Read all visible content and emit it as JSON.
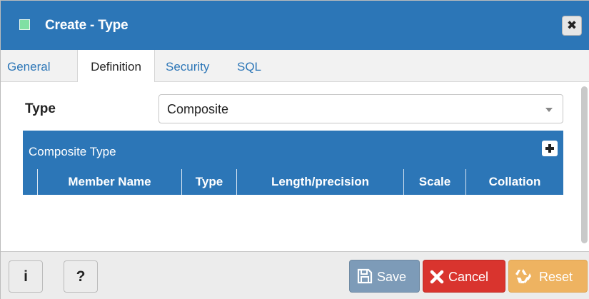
{
  "dialog": {
    "title": "Create - Type",
    "close_glyph": "✖",
    "icon": "type-icon"
  },
  "tabs": [
    {
      "label": "General",
      "active": false
    },
    {
      "label": "Definition",
      "active": true
    },
    {
      "label": "Security",
      "active": false
    },
    {
      "label": "SQL",
      "active": false
    }
  ],
  "form": {
    "type_label": "Type",
    "type_value": "Composite"
  },
  "composite": {
    "title": "Composite Type",
    "columns": [
      "Member Name",
      "Type",
      "Length/precision",
      "Scale",
      "Collation"
    ]
  },
  "footer": {
    "info_label": "i",
    "help_label": "?",
    "save_label": "Save",
    "cancel_label": "Cancel",
    "reset_label": "Reset"
  },
  "colors": {
    "header_blue": "#2c76b7",
    "save": "#7d9bb8",
    "cancel": "#d9342e",
    "reset": "#eeb361"
  }
}
